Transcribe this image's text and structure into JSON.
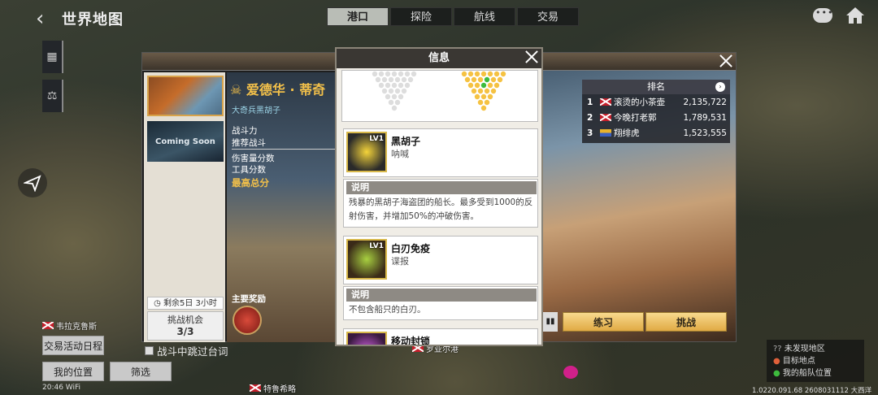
{
  "topbar": {
    "title": "世界地图",
    "tabs": [
      {
        "label": "港口",
        "active": true
      },
      {
        "label": "探险",
        "active": false
      },
      {
        "label": "航线",
        "active": false
      },
      {
        "label": "交易",
        "active": false
      }
    ]
  },
  "event": {
    "title": "爱德华 · 蒂奇",
    "subtitle": "大奇兵黑胡子",
    "stats": [
      "战斗力",
      "推荐战斗",
      "伤害量分数",
      "工具分数",
      "最高总分"
    ],
    "thumb_coming_soon": "Coming Soon",
    "timer": "剩余5日 3小时",
    "chances_label": "挑战机会",
    "chances_value": "3/3",
    "reward_label": "主要奖励"
  },
  "ranking": {
    "header": "排名",
    "rows": [
      {
        "rank": "1",
        "flag": "uk",
        "name": "滚烫的小茶壶",
        "score": "2,135,722"
      },
      {
        "rank": "2",
        "flag": "uk",
        "name": "今晚打老郭",
        "score": "1,789,531"
      },
      {
        "rank": "3",
        "flag": "nl",
        "name": "翔绯虎",
        "score": "1,523,555"
      }
    ],
    "practice_label": "练习",
    "challenge_label": "挑战"
  },
  "info_modal": {
    "title": "信息",
    "skills": [
      {
        "level": "LV1",
        "name": "黑胡子",
        "type": "呐喊",
        "desc_label": "说明",
        "desc": "残暴的黑胡子海盗团的船长。最多受到1000的反射伤害，并增加50%的冲破伤害。"
      },
      {
        "level": "LV1",
        "name": "白刃免疫",
        "type": "谍报",
        "desc_label": "说明",
        "desc": "不包含船只的白刃。"
      },
      {
        "level": "",
        "name": "移动封锁",
        "type": "",
        "desc_label": "",
        "desc": ""
      }
    ]
  },
  "bottom": {
    "trade_schedule": "交易活动日程",
    "skip_dialog": "战斗中跳过台词",
    "my_location": "我的位置",
    "filter": "筛选",
    "status_bar": "20:46  WiFi"
  },
  "map_labels": {
    "city_top": "韦拉克鲁斯",
    "city_bottom": "特鲁希略",
    "city_mid": "罗亚尔港"
  },
  "legend": {
    "items": [
      "未发现地区",
      "目标地点",
      "我的船队位置"
    ]
  },
  "coords": "1.0220.091.68 2608031112 大西洋",
  "colors": {
    "accent_gold": "#f2c04a",
    "button_gold": "#e0aa44"
  }
}
